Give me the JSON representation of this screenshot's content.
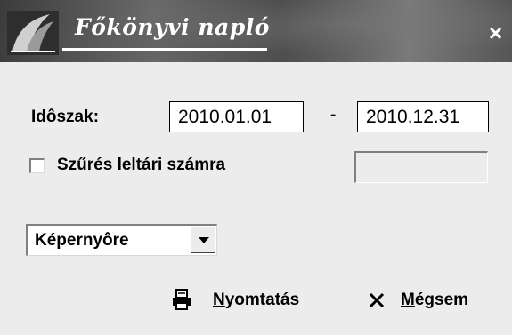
{
  "window": {
    "title": "Főkönyvi napló",
    "close_symbol": "×"
  },
  "period": {
    "label": "Idôszak:",
    "from": "2010.01.01",
    "separator": "-",
    "to": "2010.12.31"
  },
  "inventory_filter": {
    "label": "Szűrés leltári számra",
    "checked": false,
    "value": ""
  },
  "output": {
    "selected": "Képernyôre"
  },
  "buttons": {
    "print": {
      "mnemonic": "N",
      "rest": "yomtatás",
      "icon": "printer-icon"
    },
    "cancel": {
      "mnemonic": "M",
      "rest": "égsem",
      "icon": "close-icon"
    }
  }
}
